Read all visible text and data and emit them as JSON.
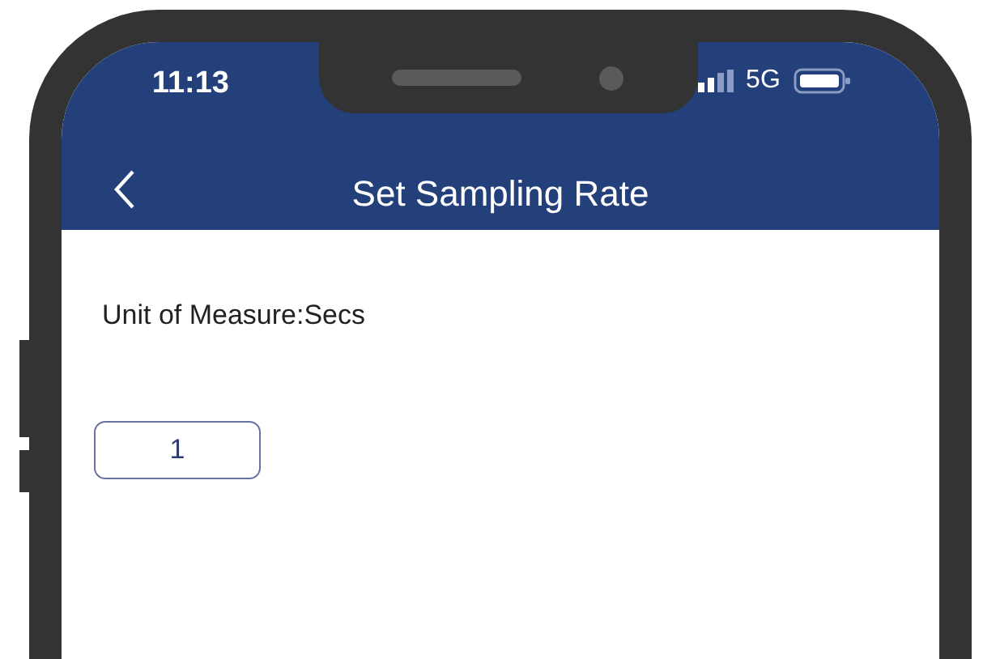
{
  "status_bar": {
    "time": "11:13",
    "network": "5G"
  },
  "nav_bar": {
    "title": "Set Sampling Rate"
  },
  "content": {
    "label": "Unit of Measure:Secs",
    "rate_field": {
      "value": "1"
    }
  }
}
